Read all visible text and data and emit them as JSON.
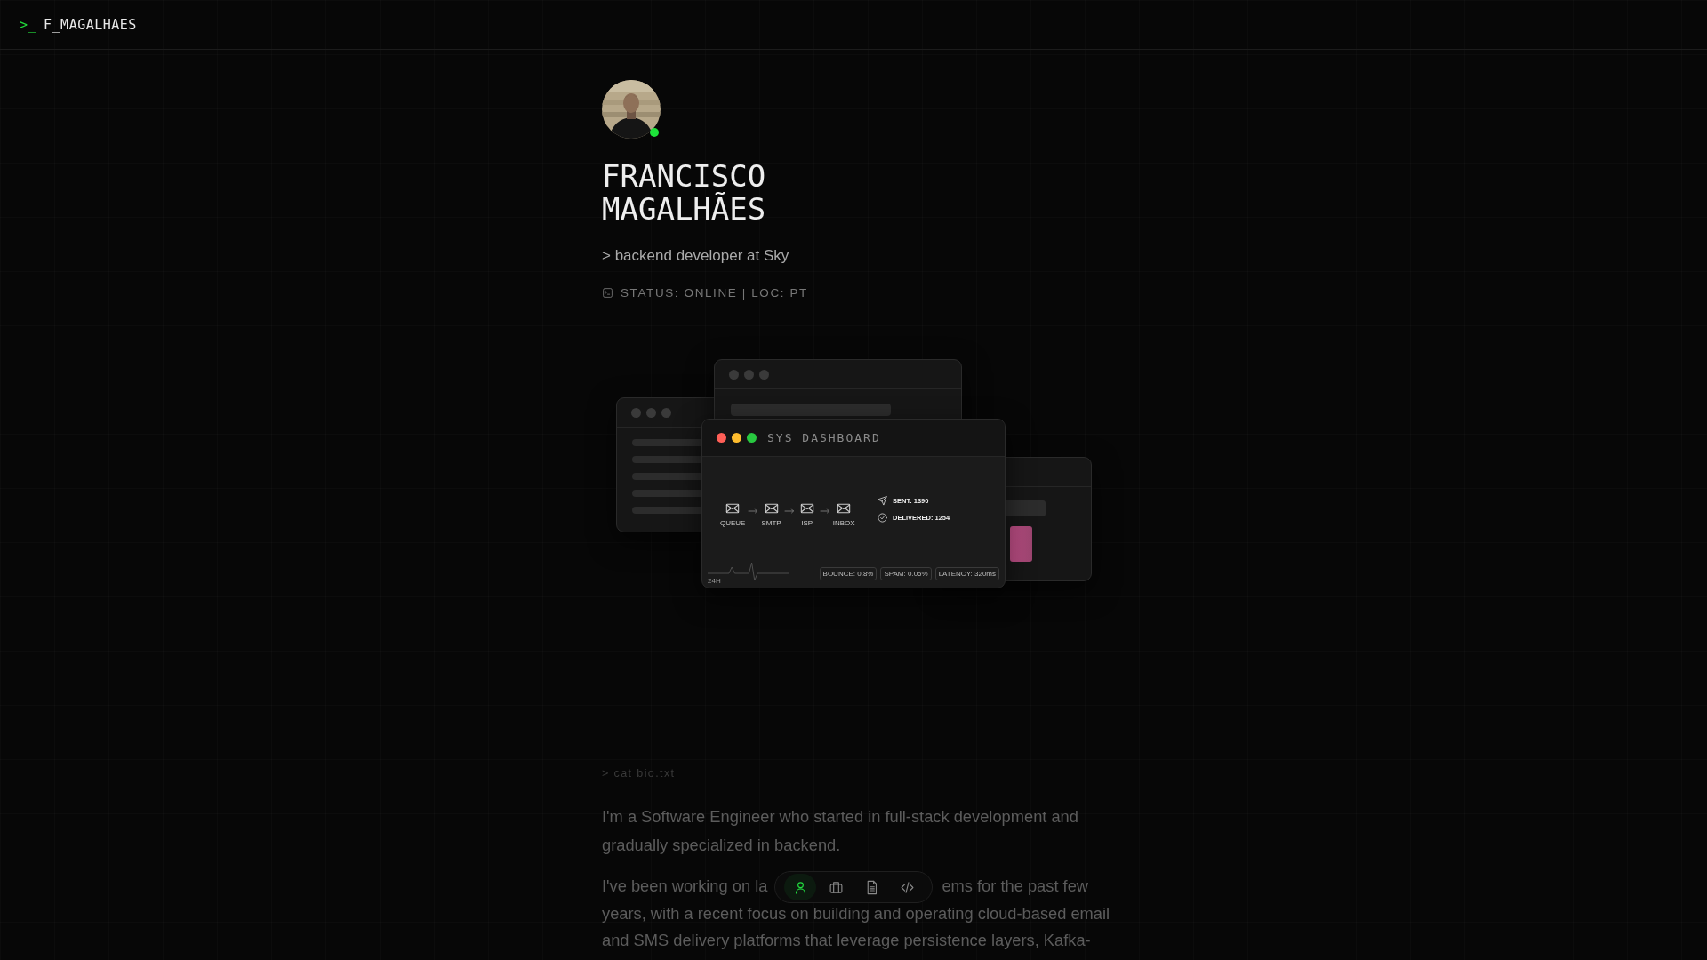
{
  "header": {
    "prompt": ">_",
    "brand": "F_MAGALHAES"
  },
  "profile": {
    "online": true,
    "name": "FRANCISCO MAGALHÃES",
    "tagline": "> backend developer at Sky",
    "status": "STATUS: ONLINE | LOC: PT"
  },
  "dashboard": {
    "title": "SYS_DASHBOARD",
    "pipeline": [
      "QUEUE",
      "SMTP",
      "ISP",
      "INBOX"
    ],
    "stats": [
      {
        "kind": "sent",
        "label": "SENT: 1390"
      },
      {
        "kind": "delivered",
        "label": "DELIVERED: 1254"
      }
    ],
    "range": "24H",
    "metrics": [
      "BOUNCE: 0.8%",
      "SPAM: 0.05%",
      "LATENCY: 320ms"
    ]
  },
  "bio": {
    "command": "> cat bio.txt",
    "paragraph_1": "I'm a Software Engineer who started in full-stack development and gradually specialized in backend.",
    "paragraph_2_line_1_start": "I've been working on la",
    "paragraph_2_line_1_end": "ems for the past few",
    "paragraph_2_rest": "years, with a recent focus on building and operating cloud-based email and SMS delivery platforms that leverage persistence layers, Kafka-"
  },
  "nav": [
    {
      "kind": "profile",
      "selected": true
    },
    {
      "kind": "work",
      "selected": false
    },
    {
      "kind": "resume",
      "selected": false
    },
    {
      "kind": "code",
      "selected": false
    }
  ]
}
